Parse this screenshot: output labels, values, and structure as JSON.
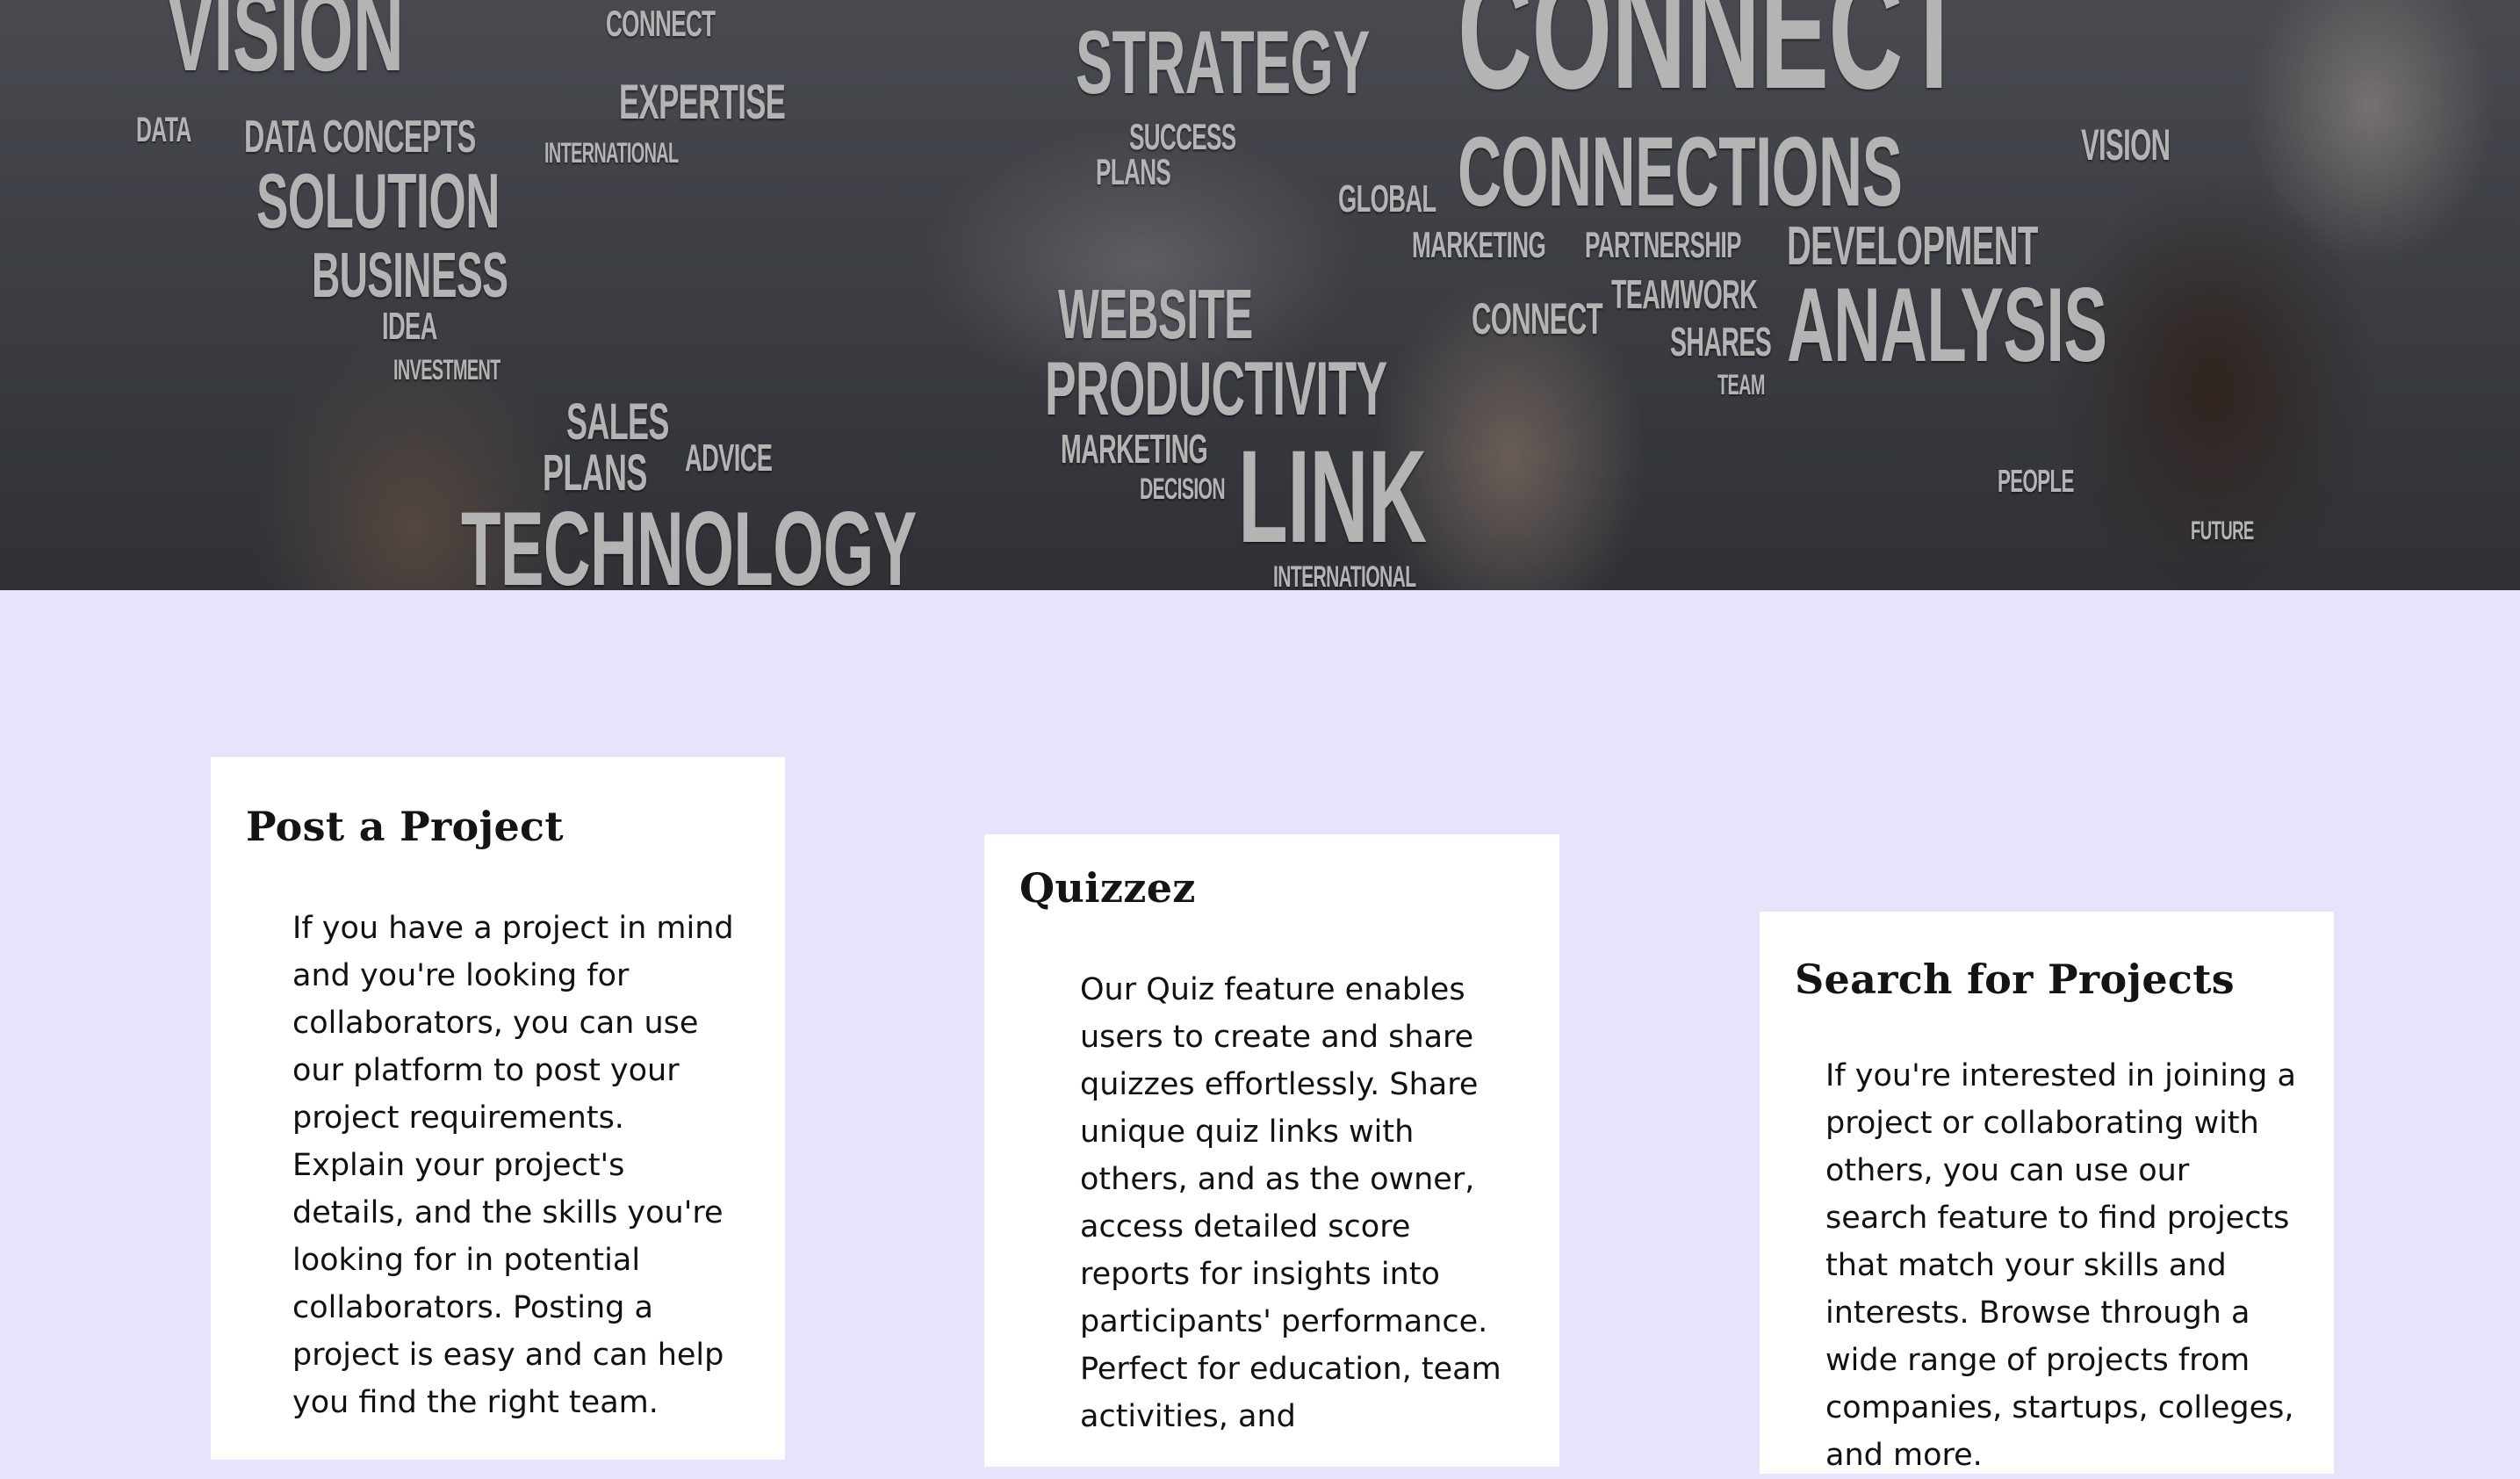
{
  "hero": {
    "words": {
      "vision_big": "VISION",
      "connect_big": "CONNECT",
      "connections": "CONNECTIONS",
      "strategy": "STRATEGY",
      "solution": "SOLUTION",
      "business": "BUSINESS",
      "data_concepts": "DATA CONCEPTS",
      "expertise": "EXPERTISE",
      "analysis": "ANALYSIS",
      "development": "DEVELOPMENT",
      "website": "WEBSITE",
      "productivity": "PRODUCTIVITY",
      "link": "LINK",
      "technology": "TECHNOLOGY",
      "teamwork": "TEAMWORK",
      "shares": "SHARES",
      "marketing": "MARKETING",
      "partnership": "PARTNERSHIP",
      "global": "GLOBAL",
      "connect_small": "CONNECT",
      "vision_small": "VISION",
      "sales": "SALES",
      "plans": "PLANS",
      "advice": "ADVICE",
      "idea": "IDEA",
      "investment": "INVESTMENT",
      "marketing_small": "MARKETING",
      "decision": "DECISION",
      "success": "SUCCESS",
      "plans_small": "PLANS",
      "people": "PEOPLE",
      "team": "TEAM",
      "international": "INTERNATIONAL",
      "international_small": "INTERNATIONAL",
      "future": "FUTURE",
      "data": "DATA",
      "connect_top": "CONNECT"
    }
  },
  "cards": [
    {
      "title": "Post a Project",
      "body": "If you have a project in mind and you're looking for collaborators, you can use our platform to post your project requirements. Explain your project's details, and the skills you're looking for in potential collaborators. Posting a project is easy and can help you find the right team."
    },
    {
      "title": "Quizzez",
      "body": "Our Quiz feature enables users to create and share quizzes effortlessly. Share unique quiz links with others, and as the owner, access detailed score reports for insights into participants' performance. Perfect for education, team activities, and"
    },
    {
      "title": "Search for Projects",
      "body": "If you're interested in joining a project or collaborating with others, you can use our search feature to find projects that match your skills and interests. Browse through a wide range of projects from companies, startups, colleges, and more."
    }
  ]
}
